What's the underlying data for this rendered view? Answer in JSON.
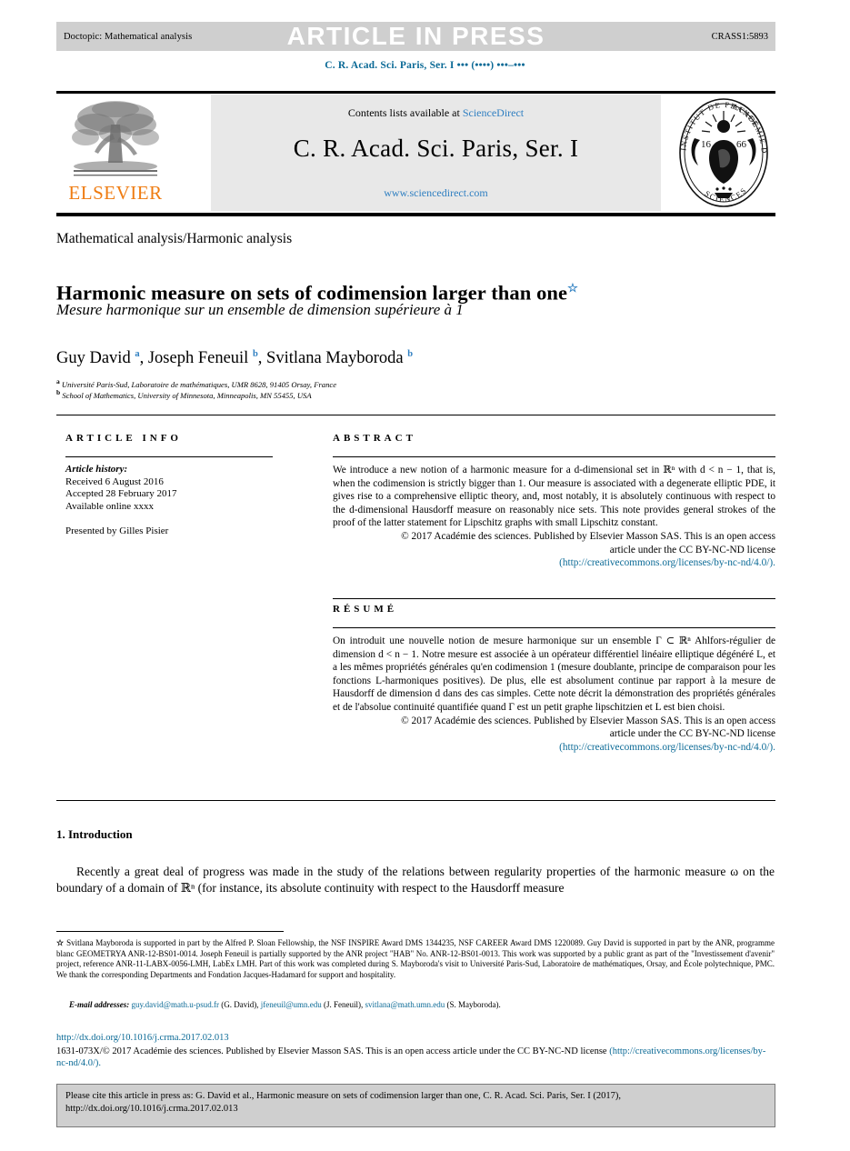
{
  "running_head": {
    "left": "Doctopic: Mathematical analysis",
    "center": "ARTICLE IN PRESS",
    "right": "CRASS1:5893"
  },
  "journal_line": "C. R. Acad. Sci. Paris, Ser. I ••• (••••) •••–•••",
  "masthead": {
    "contents_prefix": "Contents lists available at ",
    "contents_link": "ScienceDirect",
    "journal_title": "C. R. Acad. Sci. Paris, Ser. I",
    "url": "www.sciencedirect.com",
    "publisher_logo_word": "ELSEVIER",
    "seal": {
      "top_text": "INSTITUT DE FRANCE",
      "bottom_text": "ACADÉMIE DES SCIENCES",
      "year_left": "16",
      "year_right": "66"
    }
  },
  "article": {
    "subject": "Mathematical analysis/Harmonic analysis",
    "title_en": "Harmonic measure on sets of codimension larger than one",
    "title_star": "☆",
    "title_fr": "Mesure harmonique sur un ensemble de dimension supérieure à 1",
    "authors_html": "Guy David <sup>a</sup>, Joseph Feneuil <sup>b</sup>, Svitlana Mayboroda <sup>b</sup>",
    "affiliation_a": "Université Paris-Sud, Laboratoire de mathématiques, UMR 8628, 91405 Orsay, France",
    "affiliation_b": "School of Mathematics, University of Minnesota, Minneapolis, MN 55455, USA",
    "affiliation_a_mark": "a",
    "affiliation_b_mark": "b"
  },
  "article_info": {
    "heading": "ARTICLE INFO",
    "history_label": "Article history:",
    "received": "Received 6 August 2016",
    "accepted": "Accepted 28 February 2017",
    "available": "Available online xxxx",
    "presented_by": "Presented by Gilles Pisier"
  },
  "abstract": {
    "heading": "ABSTRACT",
    "body": "We introduce a new notion of a harmonic measure for a d-dimensional set in ℝⁿ with d < n − 1, that is, when the codimension is strictly bigger than 1. Our measure is associated with a degenerate elliptic PDE, it gives rise to a comprehensive elliptic theory, and, most notably, it is absolutely continuous with respect to the d-dimensional Hausdorff measure on reasonably nice sets. This note provides general strokes of the proof of the latter statement for Lipschitz graphs with small Lipschitz constant.",
    "copyright_1": "© 2017 Académie des sciences. Published by Elsevier Masson SAS. This is an open access",
    "copyright_2": "article under the CC BY-NC-ND license",
    "license_url": "(http://creativecommons.org/licenses/by-nc-nd/4.0/)."
  },
  "resume": {
    "heading": "RÉSUMÉ",
    "body": "On introduit une nouvelle notion de mesure harmonique sur un ensemble Γ ⊂ ℝⁿ Ahlfors-régulier de dimension d < n − 1. Notre mesure est associée à un opérateur différentiel linéaire elliptique dégénéré L, et a les mêmes propriétés générales qu'en codimension 1 (mesure doublante, principe de comparaison pour les fonctions L-harmoniques positives). De plus, elle est absolument continue par rapport à la mesure de Hausdorff de dimension d dans des cas simples. Cette note décrit la démonstration des propriétés générales et de l'absolue continuité quantifiée quand Γ est un petit graphe lipschitzien et L est bien choisi.",
    "copyright_1": "© 2017 Académie des sciences. Published by Elsevier Masson SAS. This is an open access",
    "copyright_2": "article under the CC BY-NC-ND license",
    "license_url": "(http://creativecommons.org/licenses/by-nc-nd/4.0/)."
  },
  "body": {
    "section_title": "1. Introduction",
    "paragraph": "Recently a great deal of progress was made in the study of the relations between regularity properties of the harmonic measure ω on the boundary of a domain of ℝⁿ (for instance, its absolute continuity with respect to the Hausdorff measure"
  },
  "footnotes": {
    "star_mark": "☆",
    "funding": "Svitlana Mayboroda is supported in part by the Alfred P. Sloan Fellowship, the NSF INSPIRE Award DMS 1344235, NSF CAREER Award DMS 1220089. Guy David is supported in part by the ANR, programme blanc GEOMETRYA ANR-12-BS01-0014. Joseph Feneuil is partially supported by the ANR project \"HAB\" No. ANR-12-BS01-0013. This work was supported by a public grant as part of the \"Investissement d'avenir\" project, reference ANR-11-LABX-0056-LMH, LabEx LMH. Part of this work was completed during S. Mayboroda's visit to Université Paris-Sud, Laboratoire de mathématiques, Orsay, and École polytechnique, PMC. We thank the corresponding Departments and Fondation Jacques-Hadamard for support and hospitality.",
    "email_label": "E-mail addresses:",
    "emails": [
      {
        "address": "guy.david@math.u-psud.fr",
        "who": "(G. David),"
      },
      {
        "address": "jfeneuil@umn.edu",
        "who": "(J. Feneuil),"
      },
      {
        "address": "svitlana@math.umn.edu",
        "who": "(S. Mayboroda)."
      }
    ]
  },
  "footer": {
    "doi": "http://dx.doi.org/10.1016/j.crma.2017.02.013",
    "copyright": "1631-073X/© 2017 Académie des sciences. Published by Elsevier Masson SAS. This is an open access article under the CC BY-NC-ND license",
    "license_url": "(http://creativecommons.org/licenses/by-nc-nd/4.0/)."
  },
  "cite_box": {
    "line1": "Please cite this article in press as: G. David et al., Harmonic measure on sets of codimension larger than one, C. R. Acad. Sci. Paris, Ser. I (2017),",
    "line2": "http://dx.doi.org/10.1016/j.crma.2017.02.013"
  },
  "colors": {
    "link": "#0b6a96",
    "science_direct": "#2f7fc1",
    "elsevier_orange": "#ef7c12",
    "band_grey": "#cfcfcf",
    "masthead_grey": "#e8e8e8"
  }
}
